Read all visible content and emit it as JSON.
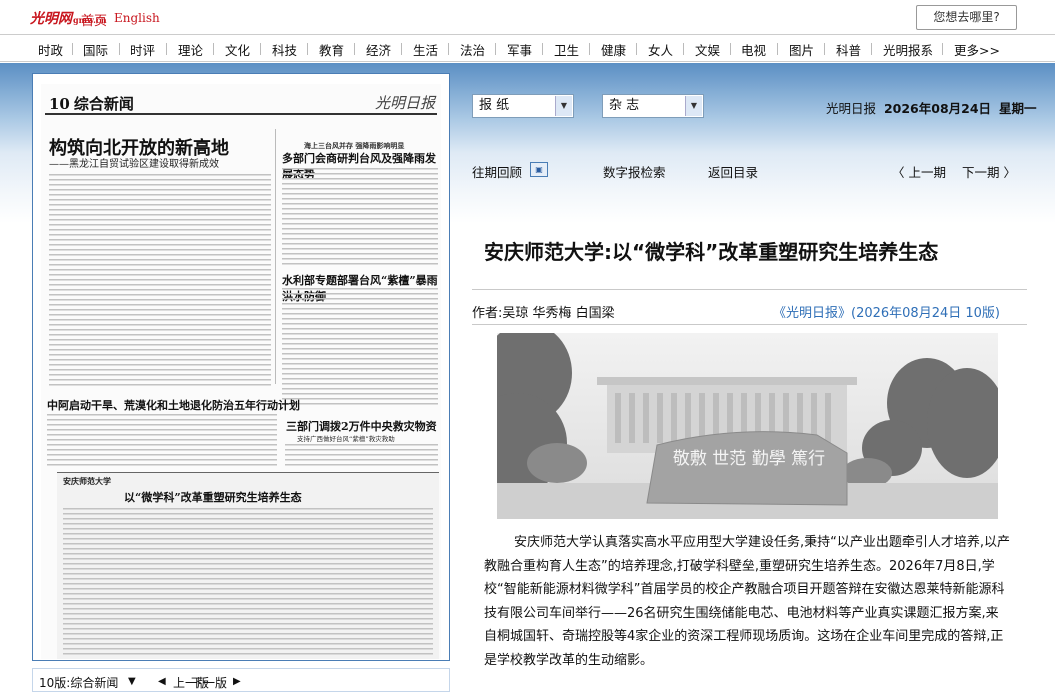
{
  "header": {
    "logo": "光明网",
    "logo_sub": "gmw.cn",
    "home": "首页",
    "english": "English",
    "search_placeholder": "您想去哪里?"
  },
  "nav": [
    "时政",
    "国际",
    "时评",
    "理论",
    "文化",
    "科技",
    "教育",
    "经济",
    "生活",
    "法治",
    "军事",
    "卫生",
    "健康",
    "女人",
    "文娱",
    "电视",
    "图片",
    "科普",
    "光明报系",
    "更多>>"
  ],
  "selectors": {
    "paper": "报 纸",
    "magazine": "杂 志"
  },
  "date": {
    "paper_name": "光明日报",
    "date": "2026年08月24日",
    "weekday": "星期一"
  },
  "toolbar": {
    "past": "往期回顾",
    "digital": "数字报检索",
    "back": "返回目录",
    "prev": "〈 上一期",
    "next": "下一期 〉"
  },
  "newspaper": {
    "page_num": "10",
    "page_name": "综合新闻",
    "masthead": "光明日报",
    "art1_title": "构筑向北开放的新高地",
    "art1_sub": "——黑龙江自贸试验区建设取得新成效",
    "art2_kicker": "海上三台风并存  强降雨影响明显",
    "art2_title": "多部门会商研判台风及强降雨发展态势",
    "art3_title": "水利部专题部署台风“紫檀”暴雨洪水防御",
    "art4_title": "中阿启动干旱、荒漠化和土地退化防治五年行动计划",
    "art5_title": "三部门调拨2万件中央救灾物资",
    "art5_sub": "支持广西做好台风“紫檀”救灾救助",
    "highlight_kicker": "安庆师范大学",
    "highlight_title": "以“微学科”改革重塑研究生培养生态"
  },
  "paper_footer": {
    "page": "10版:综合新闻",
    "prev": "上一版",
    "next": "下一版"
  },
  "article": {
    "title": "安庆师范大学:以“微学科”改革重塑研究生培养生态",
    "byline": "作者:吴琼  华秀梅  白国梁",
    "source": "《光明日报》(2026年08月24日   10版)",
    "photo_text": "敬敷 世范 勤學 篤行",
    "body": "安庆师范大学认真落实高水平应用型大学建设任务,秉持“以产业出题牵引人才培养,以产教融合重构育人生态”的培养理念,打破学科壁垒,重塑研究生培养生态。2026年7月8日,学校“智能新能源材料微学科”首届学员的校企产教融合项目开题答辩在安徽达恩莱特新能源科技有限公司车间举行——26名研究生围绕储能电芯、电池材料等产业真实课题汇报方案,来自桐城国轩、奇瑞控股等4家企业的资深工程师现场质询。这场在企业车间里完成的答辩,正是学校教学改革的生动缩影。"
  }
}
